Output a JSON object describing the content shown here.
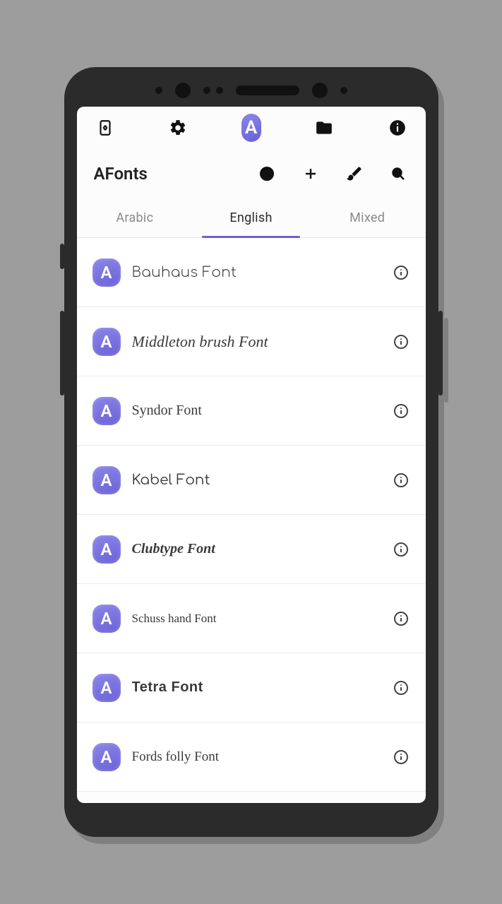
{
  "app": {
    "title": "AFonts",
    "logo_letter": "A"
  },
  "tabs": [
    {
      "label": "Arabic",
      "active": false
    },
    {
      "label": "English",
      "active": true
    },
    {
      "label": "Mixed",
      "active": false
    }
  ],
  "fonts": [
    {
      "name": "Bauhaus Font",
      "style": "style-bauhaus"
    },
    {
      "name": "Middleton brush Font",
      "style": "style-script"
    },
    {
      "name": "Syndor Font",
      "style": "style-serif"
    },
    {
      "name": "Kabel Font",
      "style": "style-kabel"
    },
    {
      "name": "Clubtype Font",
      "style": "style-bold"
    },
    {
      "name": "Schuss hand Font",
      "style": "style-narrow"
    },
    {
      "name": "Tetra Font",
      "style": "style-tetra"
    },
    {
      "name": "Fords folly Font",
      "style": "style-hand"
    }
  ]
}
